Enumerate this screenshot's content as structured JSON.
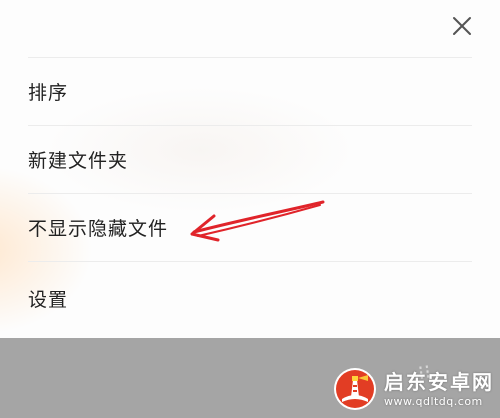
{
  "menu": {
    "items": [
      {
        "label": "排序"
      },
      {
        "label": "新建文件夹"
      },
      {
        "label": "不显示隐藏文件"
      },
      {
        "label": "设置"
      }
    ]
  },
  "close": {
    "icon": "close-icon"
  },
  "annotation": {
    "icon": "red-arrow-icon",
    "color": "#e0242a"
  },
  "watermark": {
    "title": "启东安卓网",
    "url": "www.qdltdq.com",
    "logo_icon": "lighthouse-logo-icon",
    "accent_color": "#e23d24"
  },
  "colors": {
    "sheet_background": "#fdfdfd",
    "divider": "#ececec",
    "text": "#222222",
    "overlay": "#a5a5a5"
  }
}
